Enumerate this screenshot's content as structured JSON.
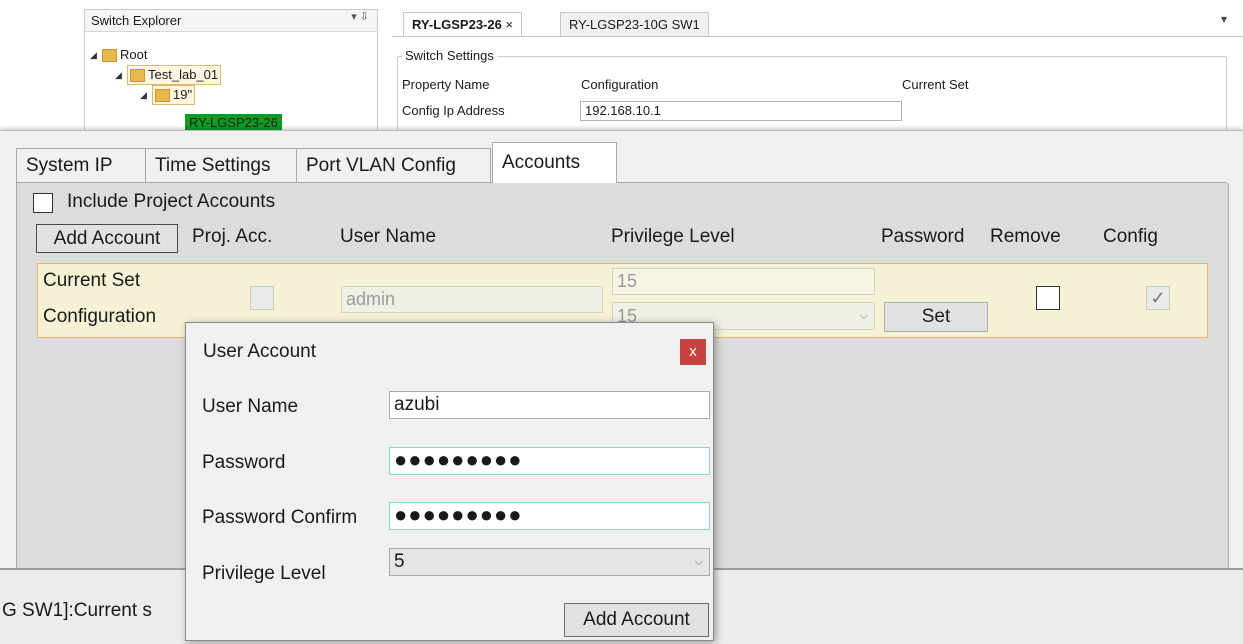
{
  "explorer": {
    "title": "Switch Explorer",
    "pin": "▾ ⇩",
    "tree": [
      {
        "label": "Root",
        "level": 0
      },
      {
        "label": "Test_lab_01",
        "level": 1
      },
      {
        "label": "19\"",
        "level": 2
      },
      {
        "label": "RY-LGSP23-26",
        "level": 3
      }
    ]
  },
  "doc_tabs": {
    "tab1": "RY-LGSP23-26",
    "tab1_close": "×",
    "tab2": "RY-LGSP23-10G SW1",
    "overflow": "▾"
  },
  "switch_settings": {
    "title": "Switch Settings",
    "col_property": "Property Name",
    "col_config": "Configuration",
    "col_current": "Current Set",
    "row_label": "Config Ip Address",
    "row_value": "192.168.10.1"
  },
  "tabs": [
    "System IP",
    "Time Settings",
    "Port VLAN Config",
    "Accounts"
  ],
  "accounts": {
    "include_label": "Include Project Accounts",
    "add_button": "Add Account",
    "headers": {
      "proj": "Proj. Acc.",
      "user": "User Name",
      "privilege": "Privilege Level",
      "password": "Password",
      "remove": "Remove",
      "config": "Config"
    },
    "entry": {
      "current_label": "Current Set",
      "config_label": "Configuration",
      "username": "admin",
      "privilege_current": "15",
      "privilege_config": "15",
      "set_button": "Set",
      "config_check": "✓"
    }
  },
  "status": {
    "text": "G SW1]:Current s"
  },
  "dialog": {
    "title": "User Account",
    "close": "x",
    "username_label": "User Name",
    "username_value": "azubi",
    "password_label": "Password",
    "password_value": "●●●●●●●●●",
    "confirm_label": "Password Confirm",
    "confirm_value": "●●●●●●●●●",
    "privilege_label": "Privilege Level",
    "privilege_value": "5",
    "add_button": "Add Account"
  }
}
